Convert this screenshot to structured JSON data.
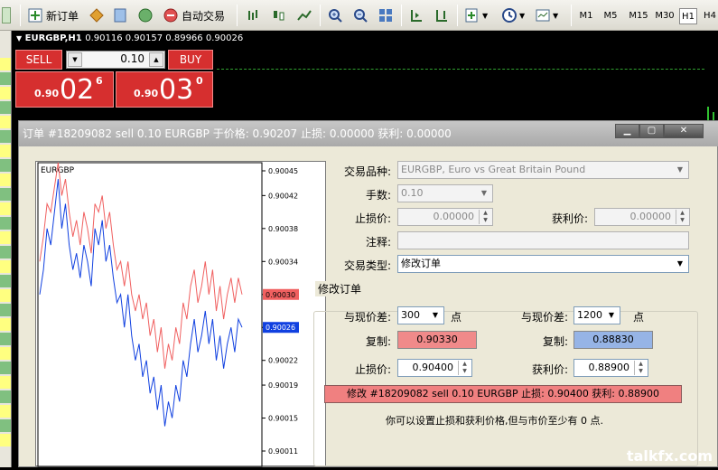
{
  "toolbar": {
    "new_order": "新订单",
    "auto_trade": "自动交易",
    "timeframes": [
      "M1",
      "M5",
      "M15",
      "M30",
      "H1",
      "H4"
    ],
    "selected_timeframe": "H1"
  },
  "chart_header": {
    "symbol": "EURGBP,H1",
    "ohlc": "0.90116 0.90157 0.89966 0.90026"
  },
  "one_click": {
    "sell_label": "SELL",
    "buy_label": "BUY",
    "lots": "0.10",
    "sell_prefix": "0.90",
    "sell_big": "02",
    "sell_sup": "6",
    "buy_prefix": "0.90",
    "buy_big": "03",
    "buy_sup": "0"
  },
  "dialog": {
    "title": "订单 #18209082 sell 0.10 EURGBP 于价格: 0.90207 止损: 0.00000 获利: 0.00000",
    "symbol_label": "交易品种:",
    "symbol_value": "EURGBP, Euro vs Great Britain Pound",
    "volume_label": "手数:",
    "volume_value": "0.10",
    "sl_label": "止损价:",
    "sl_value": "0.00000",
    "tp_label": "获利价:",
    "tp_value": "0.00000",
    "comment_label": "注释:",
    "comment_value": "",
    "type_label": "交易类型:",
    "type_value": "修改订单",
    "group_title": "修改订单",
    "level_label_left": "与现价差:",
    "level_value_left": "300",
    "points_left": "点",
    "level_label_right": "与现价差:",
    "level_value_right": "1200",
    "points_right": "点",
    "copy_label_left": "复制:",
    "copy_value_left": "0.90330",
    "copy_label_right": "复制:",
    "copy_value_right": "0.88830",
    "new_sl_label": "止损价:",
    "new_sl_value": "0.90400",
    "new_tp_label": "获利价:",
    "new_tp_value": "0.88900",
    "modify_button": "修改 #18209082 sell 0.10 EURGBP 止损: 0.90400 获利: 0.88900",
    "note": "你可以设置止损和获利价格,但与市价至少有 0 点."
  },
  "watermark": "talkfx.com",
  "chart_data": {
    "type": "line",
    "title": "EURGBP",
    "yticks": [
      "0.90045",
      "0.90042",
      "0.90038",
      "0.90034",
      "0.90030",
      "0.90026",
      "0.90022",
      "0.90019",
      "0.90015",
      "0.90011"
    ],
    "ylim": [
      0.90011,
      0.90045
    ],
    "ask_marker": "0.90030",
    "bid_marker": "0.90026",
    "colors": {
      "ask": "#f06060",
      "bid": "#1040e0"
    },
    "series": [
      {
        "values": [
          0.90034,
          0.90037,
          0.90041,
          0.9004,
          0.90043,
          0.90046,
          0.90042,
          0.90044,
          0.9004,
          0.90037,
          0.90039,
          0.90036,
          0.9004,
          0.90038,
          0.90035,
          0.90041,
          0.9004,
          0.90042,
          0.90038,
          0.9004,
          0.90036,
          0.90033,
          0.90034,
          0.90031,
          0.90034,
          0.9003,
          0.90028,
          0.9003,
          0.90027,
          0.90029,
          0.90025,
          0.90027,
          0.90023,
          0.90026,
          0.90021,
          0.90024,
          0.90022,
          0.90026,
          0.90024,
          0.90029,
          0.90027,
          0.90031,
          0.90033,
          0.90029,
          0.90031,
          0.90034,
          0.9003,
          0.90033,
          0.90028,
          0.90031,
          0.90027,
          0.9003,
          0.90032,
          0.90029,
          0.90032,
          0.9003
        ]
      },
      {
        "values": [
          0.9003,
          0.90033,
          0.90038,
          0.90036,
          0.9004,
          0.90044,
          0.90038,
          0.90041,
          0.90036,
          0.90033,
          0.90035,
          0.90032,
          0.90036,
          0.90034,
          0.90031,
          0.90038,
          0.90036,
          0.90039,
          0.90034,
          0.90036,
          0.90032,
          0.90029,
          0.9003,
          0.90026,
          0.9003,
          0.90025,
          0.90022,
          0.90024,
          0.9002,
          0.90022,
          0.90018,
          0.9002,
          0.90016,
          0.90019,
          0.90014,
          0.90017,
          0.90015,
          0.90019,
          0.90017,
          0.90022,
          0.9002,
          0.90024,
          0.90027,
          0.90023,
          0.90025,
          0.90028,
          0.90024,
          0.90027,
          0.90022,
          0.90025,
          0.90021,
          0.90024,
          0.90026,
          0.90023,
          0.90027,
          0.90026
        ]
      }
    ]
  }
}
